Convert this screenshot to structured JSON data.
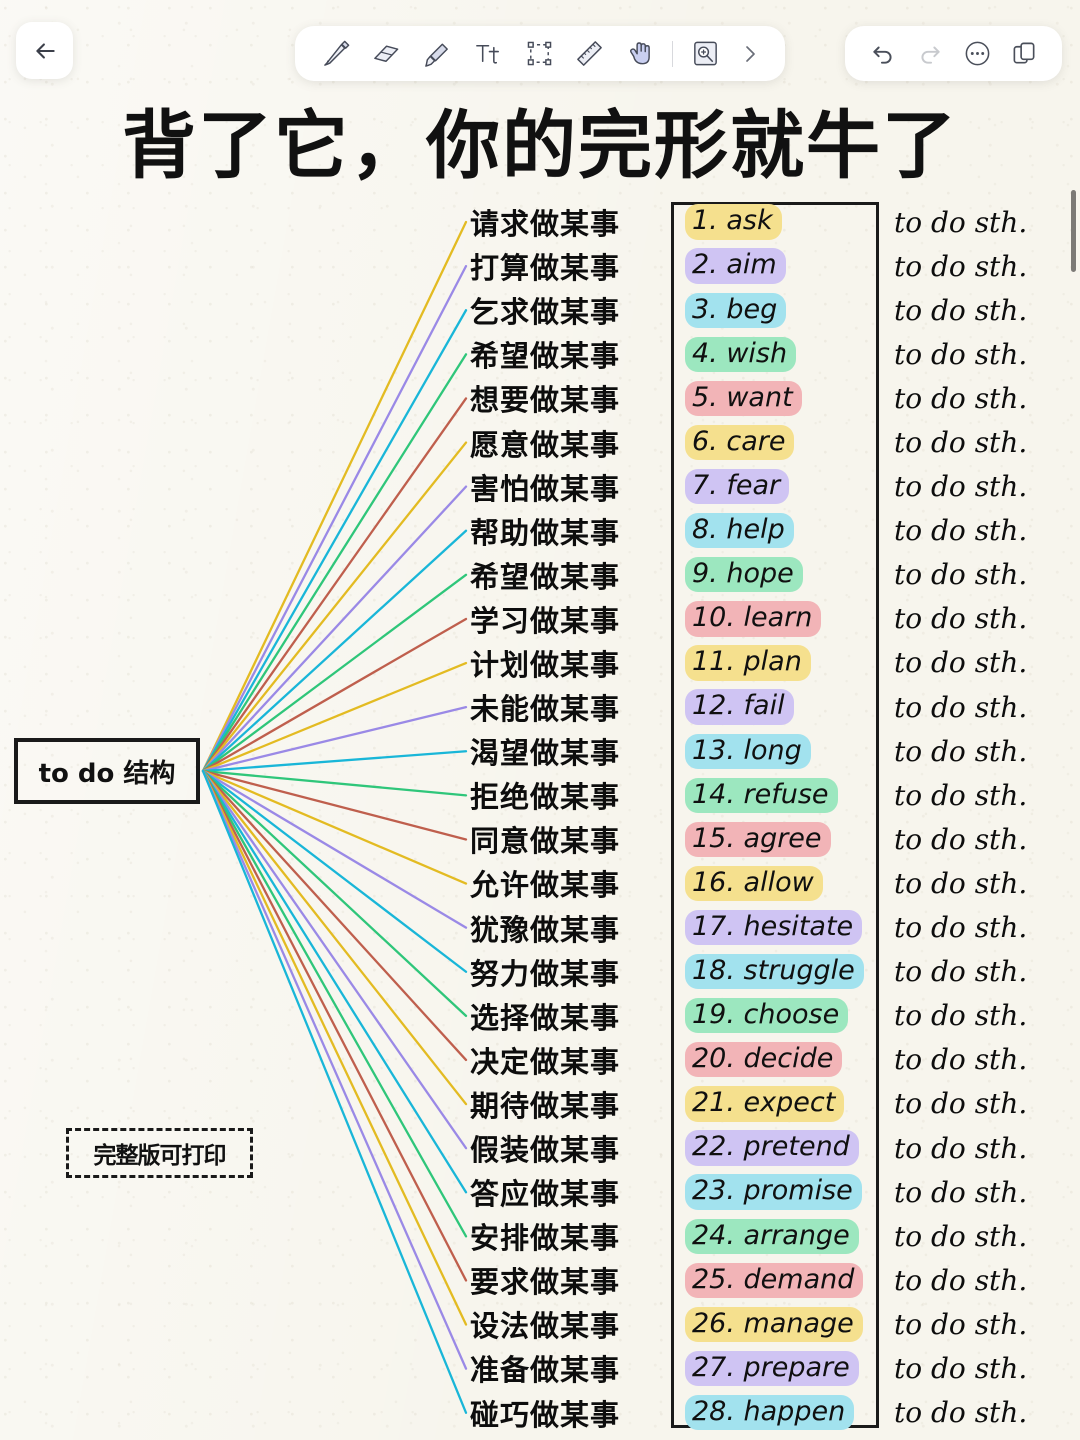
{
  "app": {
    "background_color": "#f7f5ed",
    "title": "背了它，你的完形就牛了"
  },
  "toolbar": {
    "back_label": "back-arrow",
    "tools": [
      {
        "name": "pen-tool",
        "label": "Pen"
      },
      {
        "name": "eraser-tool",
        "label": "Eraser"
      },
      {
        "name": "highlighter-tool",
        "label": "Highlighter"
      },
      {
        "name": "text-tool",
        "label": "Tt"
      },
      {
        "name": "select-tool",
        "label": "Select"
      },
      {
        "name": "ruler-tool",
        "label": "Ruler"
      },
      {
        "name": "hand-tool",
        "label": "Hand"
      },
      {
        "name": "insert-image-tool",
        "label": "Insert image"
      },
      {
        "name": "more-tools-chevron",
        "label": "More"
      }
    ],
    "actions": [
      {
        "name": "undo-button",
        "label": "Undo",
        "enabled": true
      },
      {
        "name": "redo-button",
        "label": "Redo",
        "enabled": false
      },
      {
        "name": "more-options-button",
        "label": "More options",
        "enabled": true
      },
      {
        "name": "pages-button",
        "label": "Pages",
        "enabled": true
      }
    ]
  },
  "mindmap": {
    "root_label": "to do 结构",
    "print_note": "完整版可打印",
    "sth_suffix": "to do sth.",
    "line_colors": [
      "#e3bb22",
      "#9a89e6",
      "#19b6d8",
      "#2fc67a",
      "#bf5f4d"
    ],
    "highlight_colors": [
      "#f5e08e",
      "#cfc4f3",
      "#a2e2ee",
      "#9ce7bf",
      "#f2b4b7"
    ],
    "rows": [
      {
        "index": 1,
        "cn": "请求做某事",
        "verb": "1. ask",
        "sth": "to do sth."
      },
      {
        "index": 2,
        "cn": "打算做某事",
        "verb": "2. aim",
        "sth": "to do sth."
      },
      {
        "index": 3,
        "cn": "乞求做某事",
        "verb": "3. beg",
        "sth": "to do sth."
      },
      {
        "index": 4,
        "cn": "希望做某事",
        "verb": "4. wish",
        "sth": "to do sth."
      },
      {
        "index": 5,
        "cn": "想要做某事",
        "verb": "5. want",
        "sth": "to do sth."
      },
      {
        "index": 6,
        "cn": "愿意做某事",
        "verb": "6. care",
        "sth": "to do sth."
      },
      {
        "index": 7,
        "cn": "害怕做某事",
        "verb": "7. fear",
        "sth": "to do sth."
      },
      {
        "index": 8,
        "cn": "帮助做某事",
        "verb": "8. help",
        "sth": "to do sth."
      },
      {
        "index": 9,
        "cn": "希望做某事",
        "verb": "9. hope",
        "sth": "to do sth."
      },
      {
        "index": 10,
        "cn": "学习做某事",
        "verb": "10. learn",
        "sth": "to do sth."
      },
      {
        "index": 11,
        "cn": "计划做某事",
        "verb": "11. plan",
        "sth": "to do sth."
      },
      {
        "index": 12,
        "cn": "未能做某事",
        "verb": "12. fail",
        "sth": "to do sth."
      },
      {
        "index": 13,
        "cn": "渴望做某事",
        "verb": "13. long",
        "sth": "to do sth."
      },
      {
        "index": 14,
        "cn": "拒绝做某事",
        "verb": "14. refuse",
        "sth": "to do sth."
      },
      {
        "index": 15,
        "cn": "同意做某事",
        "verb": "15. agree",
        "sth": "to do sth."
      },
      {
        "index": 16,
        "cn": "允许做某事",
        "verb": "16. allow",
        "sth": "to do sth."
      },
      {
        "index": 17,
        "cn": "犹豫做某事",
        "verb": "17. hesitate",
        "sth": "to do sth."
      },
      {
        "index": 18,
        "cn": "努力做某事",
        "verb": "18. struggle",
        "sth": "to do sth."
      },
      {
        "index": 19,
        "cn": "选择做某事",
        "verb": "19. choose",
        "sth": "to do sth."
      },
      {
        "index": 20,
        "cn": "决定做某事",
        "verb": "20. decide",
        "sth": "to do sth."
      },
      {
        "index": 21,
        "cn": "期待做某事",
        "verb": "21. expect",
        "sth": "to do sth."
      },
      {
        "index": 22,
        "cn": "假装做某事",
        "verb": "22. pretend",
        "sth": "to do sth."
      },
      {
        "index": 23,
        "cn": "答应做某事",
        "verb": "23. promise",
        "sth": "to do sth."
      },
      {
        "index": 24,
        "cn": "安排做某事",
        "verb": "24. arrange",
        "sth": "to do sth."
      },
      {
        "index": 25,
        "cn": "要求做某事",
        "verb": "25. demand",
        "sth": "to do sth."
      },
      {
        "index": 26,
        "cn": "设法做某事",
        "verb": "26. manage",
        "sth": "to do sth."
      },
      {
        "index": 27,
        "cn": "准备做某事",
        "verb": "27. prepare",
        "sth": "to do sth."
      },
      {
        "index": 28,
        "cn": "碰巧做某事",
        "verb": "28. happen",
        "sth": "to do sth."
      }
    ]
  }
}
